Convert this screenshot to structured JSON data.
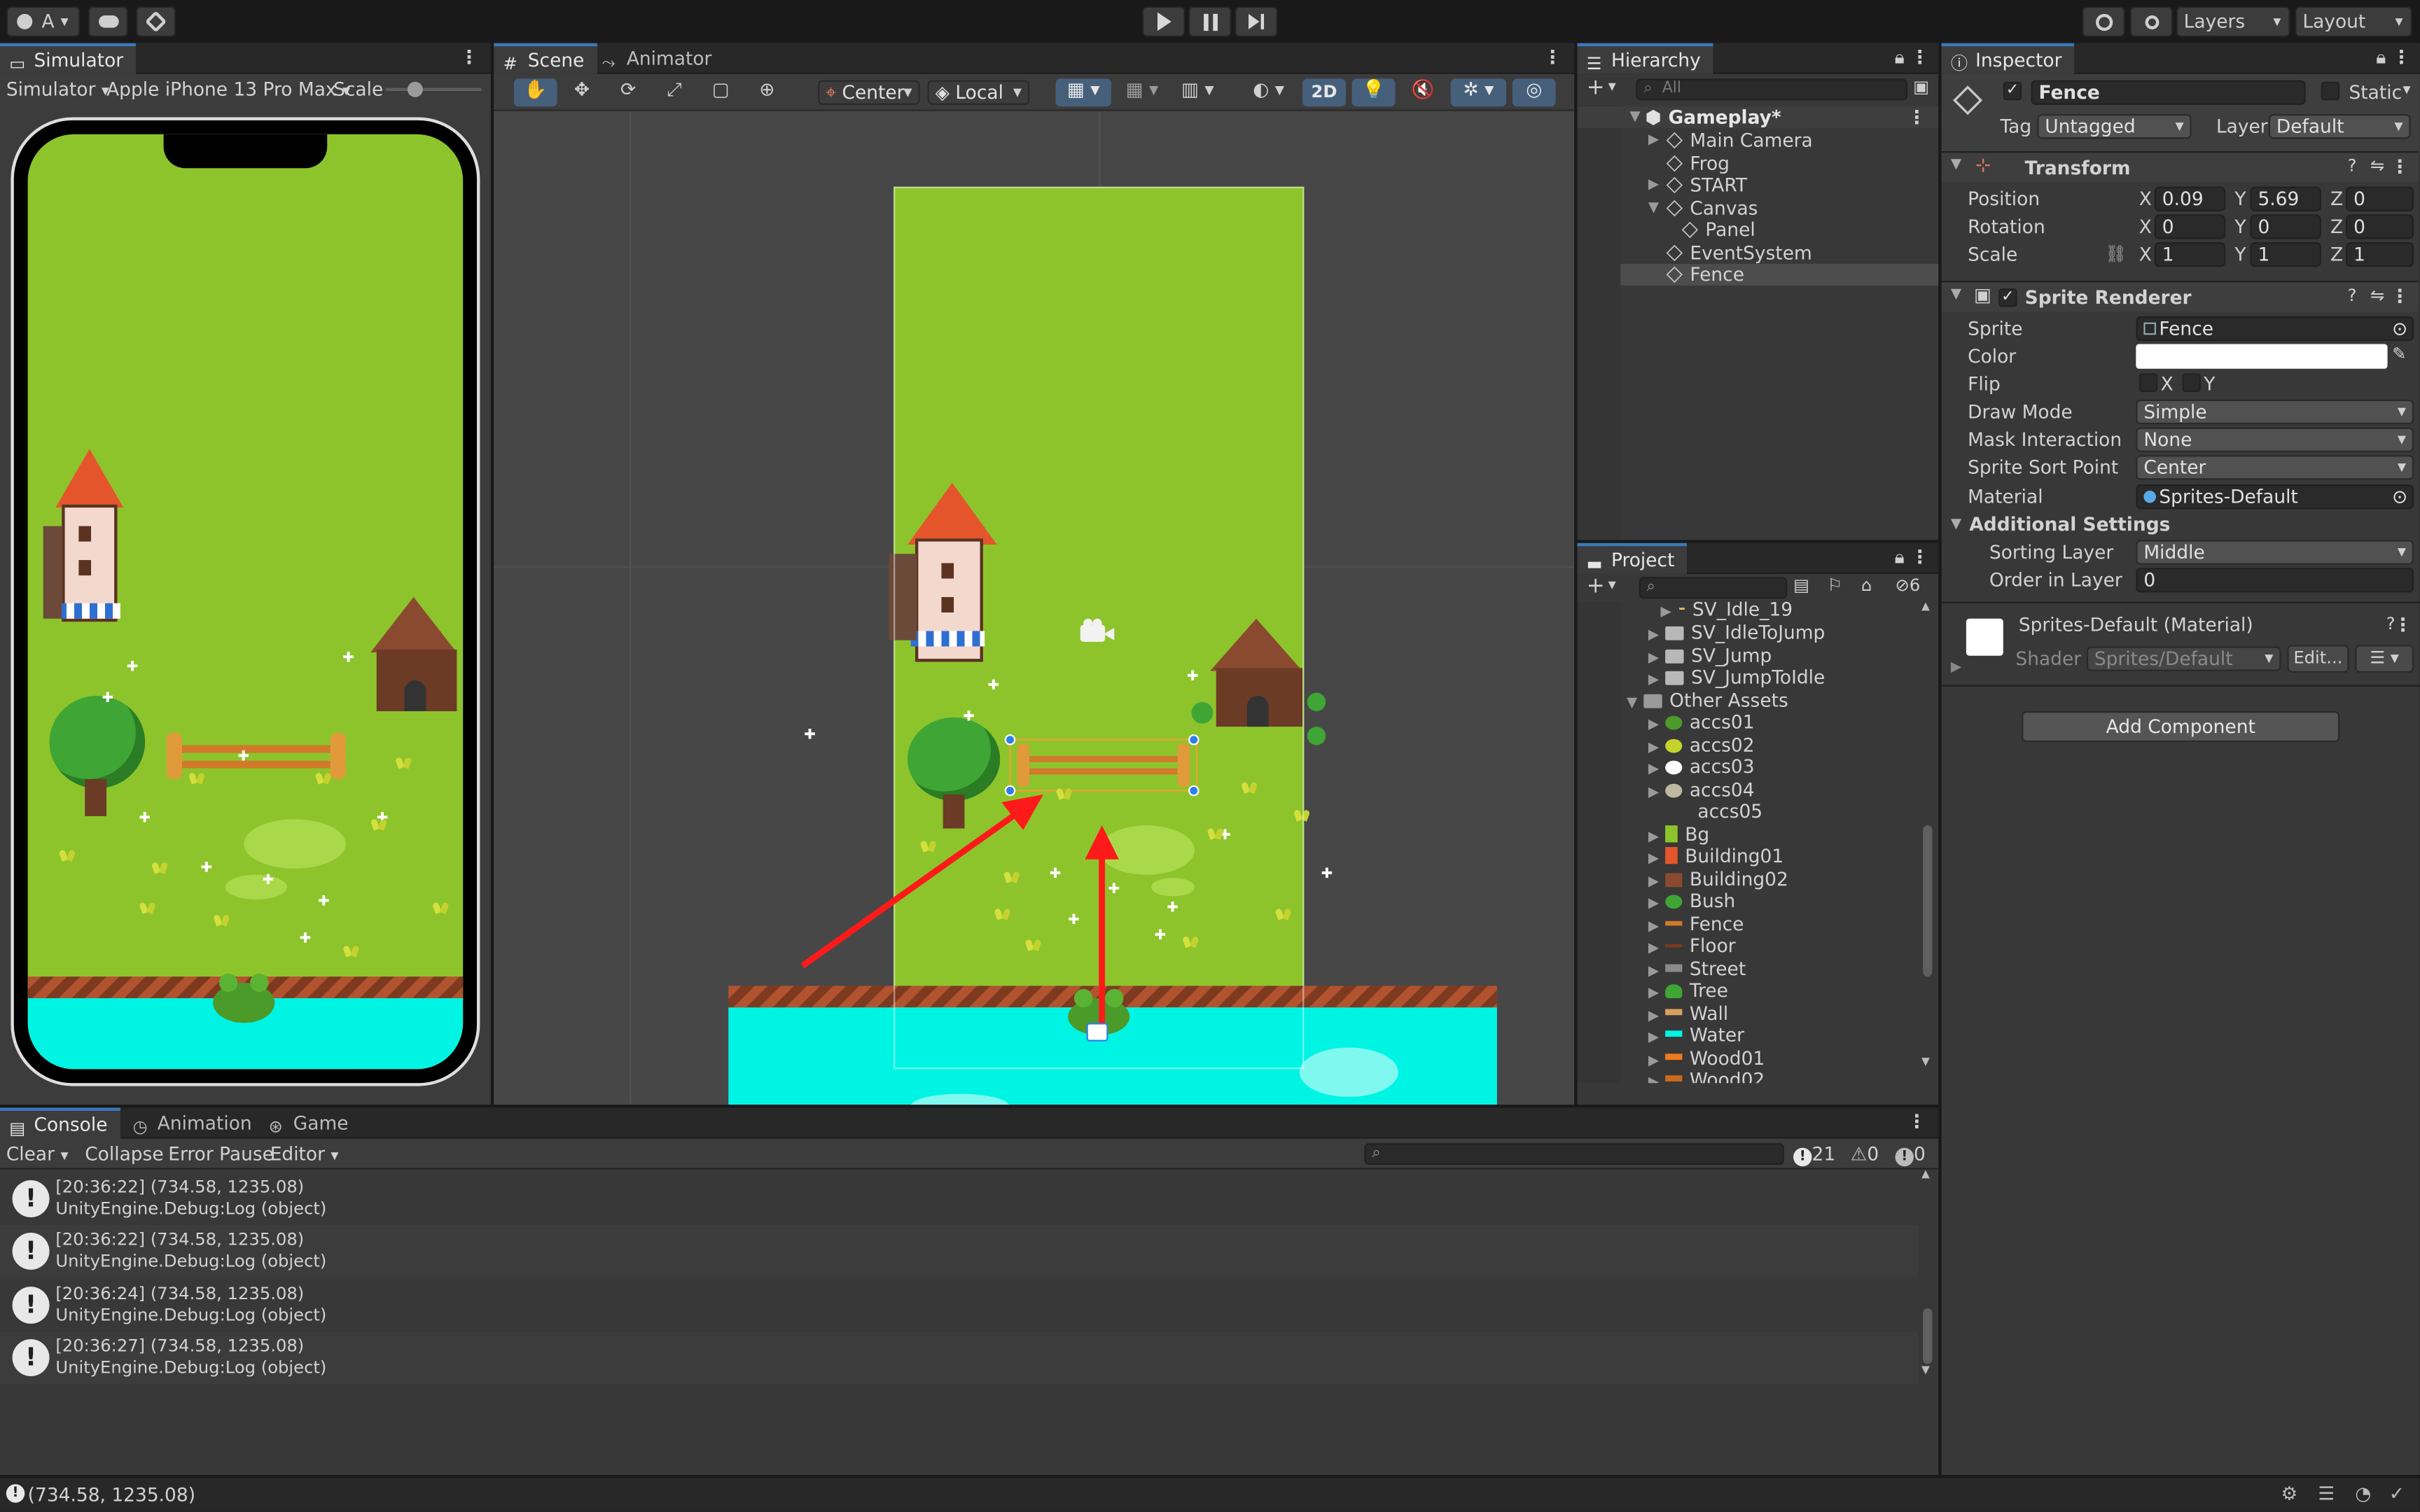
{
  "toolbar": {
    "account": "A",
    "layers": "Layers",
    "layout": "Layout"
  },
  "simulator": {
    "tab": "Simulator",
    "mode": "Simulator",
    "device": "Apple iPhone 13 Pro Max",
    "scale_label": "Scale"
  },
  "scene": {
    "tab_scene": "Scene",
    "tab_animator": "Animator",
    "pivot": "Center",
    "space": "Local",
    "mode_2d": "2D"
  },
  "hierarchy": {
    "tab": "Hierarchy",
    "search_placeholder": "All",
    "items": [
      {
        "label": "Gameplay*",
        "type": "scene"
      },
      {
        "label": "Main Camera"
      },
      {
        "label": "Frog"
      },
      {
        "label": "START"
      },
      {
        "label": "Canvas"
      },
      {
        "label": "Panel"
      },
      {
        "label": "EventSystem"
      },
      {
        "label": "Fence"
      }
    ]
  },
  "project": {
    "tab": "Project",
    "hidden_count": "6",
    "items": [
      "SV_Idle_19",
      "SV_IdleToJump",
      "SV_Jump",
      "SV_JumpToIdle",
      "Other Assets",
      "accs01",
      "accs02",
      "accs03",
      "accs04",
      "accs05",
      "Bg",
      "Building01",
      "Building02",
      "Bush",
      "Fence",
      "Floor",
      "Street",
      "Tree",
      "Wall",
      "Water",
      "Wood01",
      "Wood02"
    ]
  },
  "inspector": {
    "tab": "Inspector",
    "object_name": "Fence",
    "static_label": "Static",
    "tag_label": "Tag",
    "tag_value": "Untagged",
    "layer_label": "Layer",
    "layer_value": "Default",
    "transform": {
      "title": "Transform",
      "position_label": "Position",
      "rotation_label": "Rotation",
      "scale_label": "Scale",
      "position": {
        "x": "0.09",
        "y": "5.69",
        "z": "0"
      },
      "rotation": {
        "x": "0",
        "y": "0",
        "z": "0"
      },
      "scale": {
        "x": "1",
        "y": "1",
        "z": "1"
      },
      "axis_x": "X",
      "axis_y": "Y",
      "axis_z": "Z"
    },
    "sprite_renderer": {
      "title": "Sprite Renderer",
      "sprite_label": "Sprite",
      "sprite_value": "Fence",
      "color_label": "Color",
      "flip_label": "Flip",
      "flip_x": "X",
      "flip_y": "Y",
      "draw_mode_label": "Draw Mode",
      "draw_mode_value": "Simple",
      "mask_label": "Mask Interaction",
      "mask_value": "None",
      "sort_point_label": "Sprite Sort Point",
      "sort_point_value": "Center",
      "material_label": "Material",
      "material_value": "Sprites-Default",
      "additional_label": "Additional Settings",
      "sorting_layer_label": "Sorting Layer",
      "sorting_layer_value": "Middle",
      "order_label": "Order in Layer",
      "order_value": "0"
    },
    "material": {
      "name": "Sprites-Default (Material)",
      "shader_label": "Shader",
      "shader_value": "Sprites/Default",
      "edit_label": "Edit..."
    },
    "add_component": "Add Component"
  },
  "console": {
    "tab_console": "Console",
    "tab_animation": "Animation",
    "tab_game": "Game",
    "clear": "Clear",
    "collapse": "Collapse",
    "error_pause": "Error Pause",
    "editor": "Editor",
    "count_log": "21",
    "count_warn": "0",
    "count_error": "0",
    "logs": [
      {
        "line1": "[20:36:22] (734.58, 1235.08)",
        "line2": "UnityEngine.Debug:Log (object)"
      },
      {
        "line1": "[20:36:22] (734.58, 1235.08)",
        "line2": "UnityEngine.Debug:Log (object)"
      },
      {
        "line1": "[20:36:24] (734.58, 1235.08)",
        "line2": "UnityEngine.Debug:Log (object)"
      },
      {
        "line1": "[20:36:27] (734.58, 1235.08)",
        "line2": "UnityEngine.Debug:Log (object)"
      }
    ]
  },
  "status_bar": {
    "message": "(734.58, 1235.08)"
  },
  "colors": {
    "grass": "#8dc42c",
    "water": "#00f4e4",
    "accent": "#3a79bb",
    "arrow": "#ff1a1a"
  }
}
